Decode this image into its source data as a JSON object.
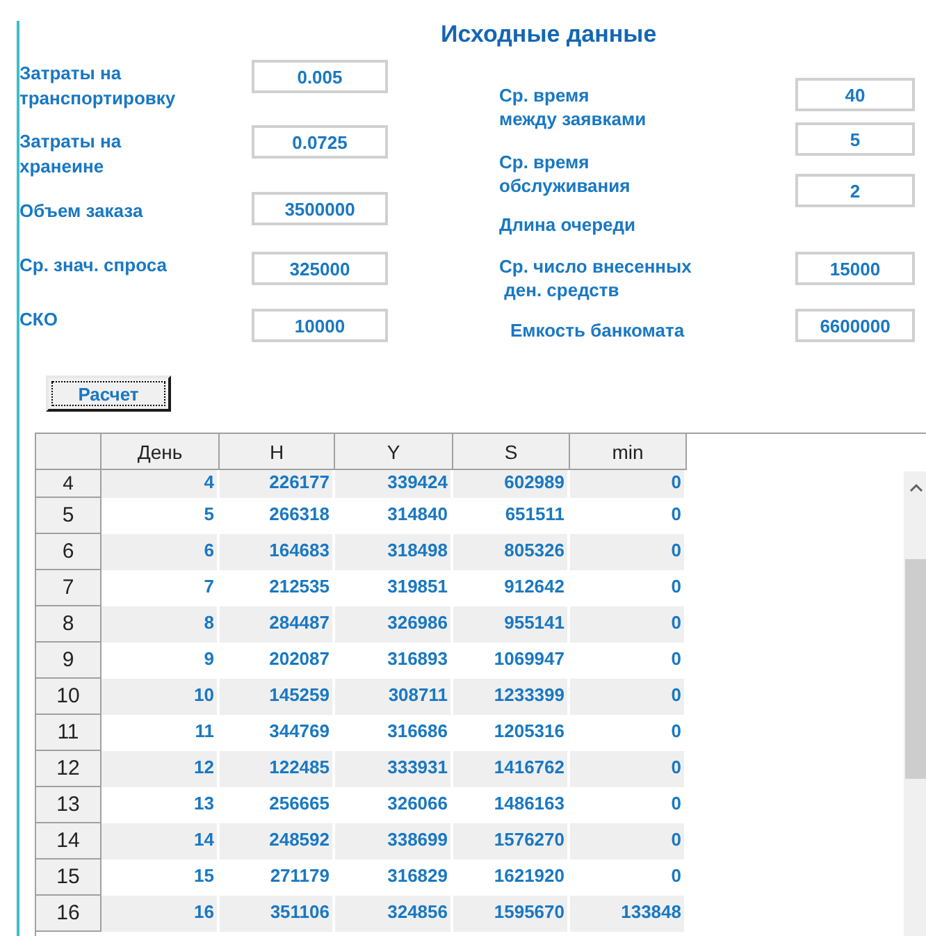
{
  "title": "Исходные данные",
  "left_fields": [
    {
      "label": "Затраты на транспортировку",
      "value": "0.005"
    },
    {
      "label": "Затраты на хранеине",
      "value": "0.0725"
    },
    {
      "label": "Объем заказа",
      "value": "3500000"
    },
    {
      "label": "Ср. знач. спроса",
      "value": "325000"
    },
    {
      "label": "СКО",
      "value": "10000"
    }
  ],
  "right_labels": [
    "Ср. время\nмежду заявками",
    "Ср. время\nобслуживания",
    "Длина очереди",
    "Ср. число внесенных\n ден. средств",
    "Емкость банкомата"
  ],
  "right_values": [
    "40",
    "5",
    "2",
    "15000",
    "6600000"
  ],
  "button": {
    "label": "Расчет",
    "focused": true
  },
  "table": {
    "columns": [
      "День",
      "H",
      "Y",
      "S",
      "min"
    ],
    "rows": [
      {
        "header": "4",
        "cells": [
          "4",
          "226177",
          "339424",
          "602989",
          "0"
        ]
      },
      {
        "header": "5",
        "cells": [
          "5",
          "266318",
          "314840",
          "651511",
          "0"
        ]
      },
      {
        "header": "6",
        "cells": [
          "6",
          "164683",
          "318498",
          "805326",
          "0"
        ]
      },
      {
        "header": "7",
        "cells": [
          "7",
          "212535",
          "319851",
          "912642",
          "0"
        ]
      },
      {
        "header": "8",
        "cells": [
          "8",
          "284487",
          "326986",
          "955141",
          "0"
        ]
      },
      {
        "header": "9",
        "cells": [
          "9",
          "202087",
          "316893",
          "1069947",
          "0"
        ]
      },
      {
        "header": "10",
        "cells": [
          "10",
          "145259",
          "308711",
          "1233399",
          "0"
        ]
      },
      {
        "header": "11",
        "cells": [
          "11",
          "344769",
          "316686",
          "1205316",
          "0"
        ]
      },
      {
        "header": "12",
        "cells": [
          "12",
          "122485",
          "333931",
          "1416762",
          "0"
        ]
      },
      {
        "header": "13",
        "cells": [
          "13",
          "256665",
          "326066",
          "1486163",
          "0"
        ]
      },
      {
        "header": "14",
        "cells": [
          "14",
          "248592",
          "338699",
          "1576270",
          "0"
        ]
      },
      {
        "header": "15",
        "cells": [
          "15",
          "271179",
          "316829",
          "1621920",
          "0"
        ]
      },
      {
        "header": "16",
        "cells": [
          "16",
          "351106",
          "324856",
          "1595670",
          "133848"
        ]
      }
    ]
  }
}
